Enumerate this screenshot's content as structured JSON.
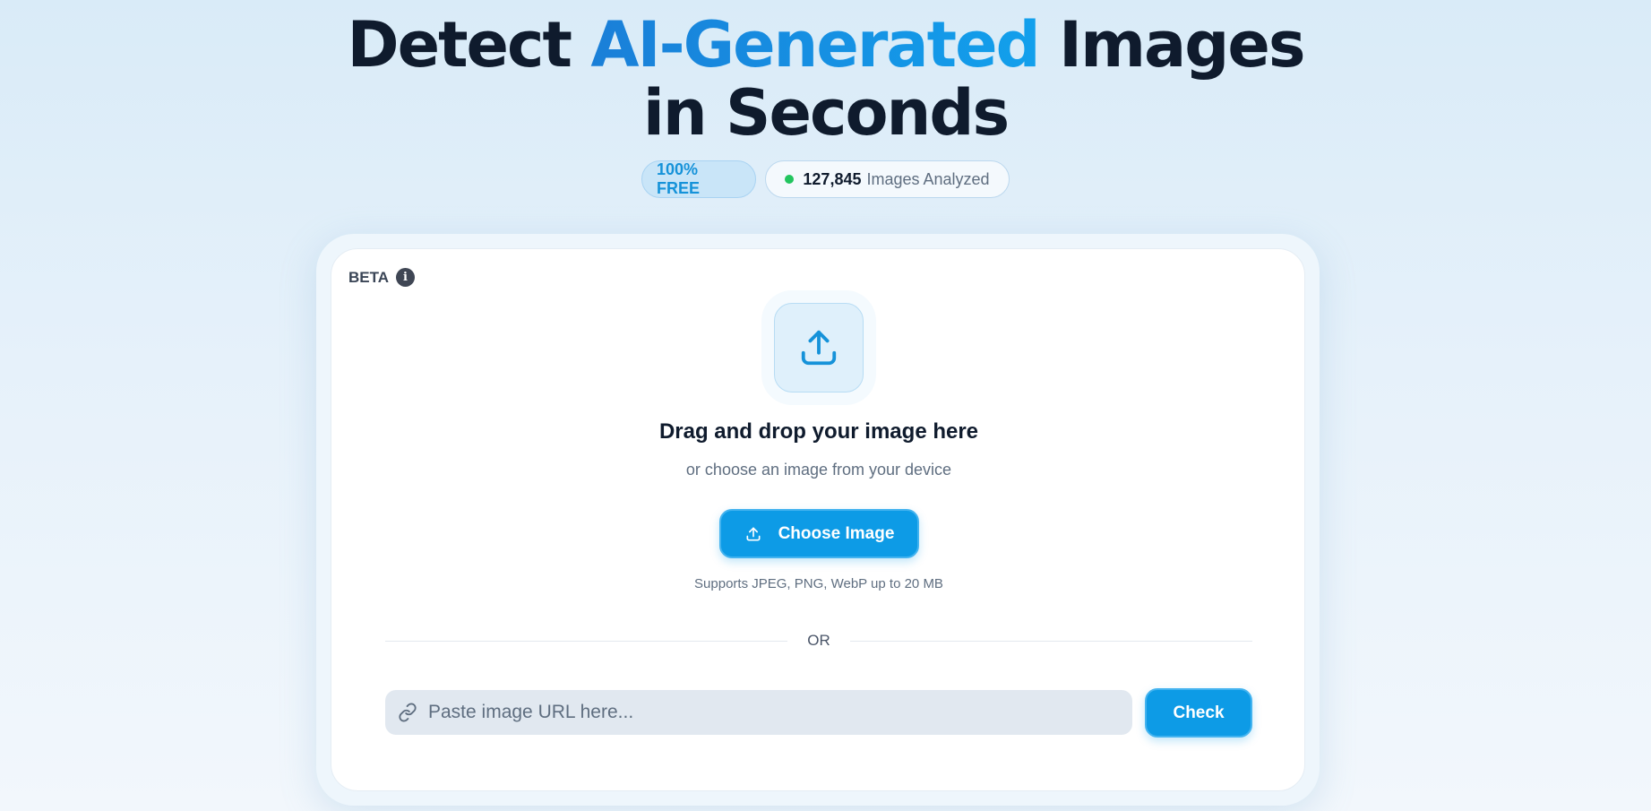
{
  "hero": {
    "title_part1": "Detect ",
    "title_accent": "AI-Generated",
    "title_part2": " Images",
    "title_line2": "in Seconds"
  },
  "badges": {
    "free_label": "100% FREE",
    "count_value": "127,845",
    "count_label": "Images Analyzed",
    "status_color": "#22c55e"
  },
  "card": {
    "beta_label": "BETA",
    "info_icon_glyph": "i",
    "drag_title": "Drag and drop your image here",
    "drag_subtitle": "or choose an image from your device",
    "choose_button_label": "Choose Image",
    "supports_text": "Supports JPEG, PNG, WebP up to 20 MB",
    "or_label": "OR",
    "url_placeholder": "Paste image URL here...",
    "url_value": "",
    "check_button_label": "Check"
  },
  "colors": {
    "accent": "#0d9be6",
    "heading": "#0f1b2d",
    "muted": "#5f6e80"
  },
  "icons": {
    "upload": "upload-icon",
    "button_upload": "upload-small-icon",
    "link": "link-icon",
    "info": "info-icon"
  }
}
